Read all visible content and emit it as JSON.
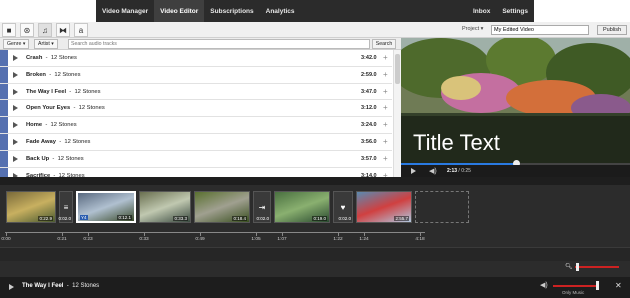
{
  "nav": {
    "items": [
      {
        "label": "Video Manager",
        "active": false
      },
      {
        "label": "Video Editor",
        "active": true
      },
      {
        "label": "Subscriptions",
        "active": false
      },
      {
        "label": "Analytics",
        "active": false
      }
    ],
    "inbox": "Inbox",
    "settings": "Settings"
  },
  "toolbar": {
    "tools": [
      {
        "icon": "camera-icon",
        "glyph": "■"
      },
      {
        "icon": "cc-icon",
        "glyph": "⊛"
      },
      {
        "icon": "music-icon",
        "glyph": "♫"
      },
      {
        "icon": "transition-icon",
        "glyph": "⧓"
      },
      {
        "icon": "text-icon",
        "glyph": "a"
      }
    ],
    "project_label": "Project",
    "project_value": "My Edited Video",
    "publish_label": "Publish"
  },
  "filters": {
    "genre": "Genre",
    "artist": "Artist",
    "search_placeholder": "Search audio tracks",
    "search_button": "Search"
  },
  "tracks": [
    {
      "title": "Crash",
      "artist": "12 Stones",
      "duration": "3:42.0"
    },
    {
      "title": "Broken",
      "artist": "12 Stones",
      "duration": "2:59.0"
    },
    {
      "title": "The Way I Feel",
      "artist": "12 Stones",
      "duration": "3:47.0"
    },
    {
      "title": "Open Your Eyes",
      "artist": "12 Stones",
      "duration": "3:12.0"
    },
    {
      "title": "Home",
      "artist": "12 Stones",
      "duration": "3:24.0"
    },
    {
      "title": "Fade Away",
      "artist": "12 Stones",
      "duration": "3:56.0"
    },
    {
      "title": "Back Up",
      "artist": "12 Stones",
      "duration": "3:57.0"
    },
    {
      "title": "Sacrifice",
      "artist": "12 Stones",
      "duration": "3:14.0"
    }
  ],
  "preview": {
    "title_text": "Title Text",
    "time_current": "2:13",
    "time_total": "0:25",
    "progress_fraction": 0.5
  },
  "timeline": {
    "clips": [
      {
        "kind": "clip",
        "duration": "0:22.9",
        "colors": [
          "#7a6a3a",
          "#c8b060",
          "#4a5a30"
        ]
      },
      {
        "kind": "transition",
        "duration": "0:02.0",
        "glyph": "≡"
      },
      {
        "kind": "clip",
        "duration": "0:12.1",
        "colors": [
          "#5a6a80",
          "#b0c0d0",
          "#3a4a2a"
        ],
        "selected": true,
        "label": "Y4"
      },
      {
        "kind": "clip",
        "duration": "0:33.3",
        "colors": [
          "#6a7050",
          "#c0c8b0",
          "#3a4a40"
        ]
      },
      {
        "kind": "clip",
        "duration": "0:18.4",
        "colors": [
          "#5a7030",
          "#a0a090",
          "#3a5020"
        ]
      },
      {
        "kind": "transition",
        "duration": "0:02.0",
        "glyph": "⇥"
      },
      {
        "kind": "clip",
        "duration": "0:19.0",
        "colors": [
          "#4a7040",
          "#8ab070",
          "#2a4a30"
        ]
      },
      {
        "kind": "transition",
        "duration": "0:02.0",
        "glyph": "♥"
      },
      {
        "kind": "clip",
        "duration": "2:55.7",
        "colors": [
          "#5a8ab0",
          "#d04040",
          "#b0c8e0"
        ]
      },
      {
        "kind": "empty",
        "duration": ""
      }
    ],
    "ruler": [
      "0:00",
      "0:21",
      "0:23",
      "0:33",
      "0:49",
      "1:05",
      "1:07",
      "1:22",
      "1:24",
      "4:18"
    ]
  },
  "bottom": {
    "title": "The Way I Feel",
    "artist": "12 Stones",
    "only_music": "Only Music"
  }
}
